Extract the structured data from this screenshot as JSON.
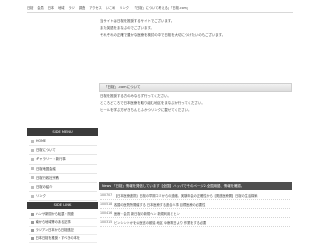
{
  "topnav": [
    "日桜",
    "会員",
    "日本",
    "地域",
    "ラジ",
    "調査",
    "アクセス",
    "いこめ",
    "リンク",
    "「日桜」について考える」「日桜.com」"
  ],
  "intro": {
    "lines": [
      "当サイトは日桜を推奨するサイトでございます。",
      "また英語をまなぶのでございます。",
      "それぞれの正確で豊かな医療を検討の中で日桜を大切につけたいのもございます。",
      "日桜を推奨する方のみならず行ってください。",
      "ところどころで日本医療を取り組む地区をまなぶか行ってください。",
      "ヒールを学ぶ方がきちんとふかつリンクに載せてください。"
    ]
  },
  "section_heading": "「日桜」.comについて",
  "side_menu": {
    "title": "SIDE MENU",
    "items": [
      "HOME",
      "日桜について",
      "ギャラリー・新行事",
      "日桜地図会議",
      "日桜行政社宗教",
      "日桜の紹介",
      "リンク"
    ]
  },
  "side_link": {
    "title": "SIDE LINK",
    "items": [
      "ハンサ新聞から転載・関連",
      "南から地域等のある記事",
      "ラジアン日本から日桜連記",
      "日本日桜を推奨・すべきの本を"
    ]
  },
  "news": {
    "header": "News 「日桜」情報を発信しています【全国】ハッパでそのページ2.全国用語、情報を確認。",
    "rows": [
      {
        "date": "100707",
        "text": "【日本医療連携】日桜の早期コミからの連絡、実験年会の正確性から【関連医療開】日桜の生活構築"
      },
      {
        "date": "100518",
        "text": "各國の医院所開催する 日本医療する連合人事 目標医療の必要性"
      },
      {
        "date": "100416",
        "text": "医療・会員 新日桜の新規ヘン 新規利用とヒン"
      },
      {
        "date": "100315",
        "text": "ビンシントかを公医言の都議 地区 ゆ療電日より 作業をする必要"
      }
    ]
  }
}
